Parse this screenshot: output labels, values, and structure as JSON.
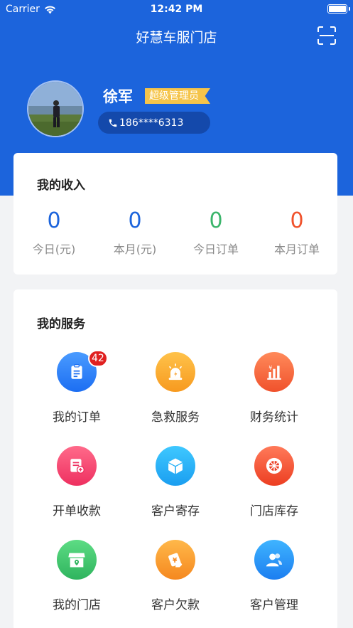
{
  "status_bar": {
    "carrier": "Carrier",
    "time": "12:42 PM"
  },
  "nav": {
    "title": "好慧车服门店"
  },
  "profile": {
    "name": "徐军",
    "role": "超级管理员",
    "phone": "186****6313"
  },
  "income": {
    "title": "我的收入",
    "stats": [
      {
        "value": "0",
        "label": "今日(元)",
        "color": "#1c64dc"
      },
      {
        "value": "0",
        "label": "本月(元)",
        "color": "#1c64dc"
      },
      {
        "value": "0",
        "label": "今日订单",
        "color": "#3bb56b"
      },
      {
        "value": "0",
        "label": "本月订单",
        "color": "#f0522c"
      }
    ]
  },
  "services": {
    "title": "我的服务",
    "items": [
      {
        "label": "我的订单",
        "icon": "clipboard-icon",
        "badge": "42"
      },
      {
        "label": "急救服务",
        "icon": "siren-icon"
      },
      {
        "label": "财务统计",
        "icon": "bar-chart-icon"
      },
      {
        "label": "开单收款",
        "icon": "invoice-icon"
      },
      {
        "label": "客户寄存",
        "icon": "box-icon"
      },
      {
        "label": "门店库存",
        "icon": "tire-icon"
      },
      {
        "label": "我的门店",
        "icon": "store-icon"
      },
      {
        "label": "客户欠款",
        "icon": "debt-icon"
      },
      {
        "label": "客户管理",
        "icon": "users-icon"
      }
    ]
  },
  "colors": {
    "primary": "#1c64dc",
    "badge_gold": "#f5c44a",
    "notification_red": "#e02020"
  }
}
